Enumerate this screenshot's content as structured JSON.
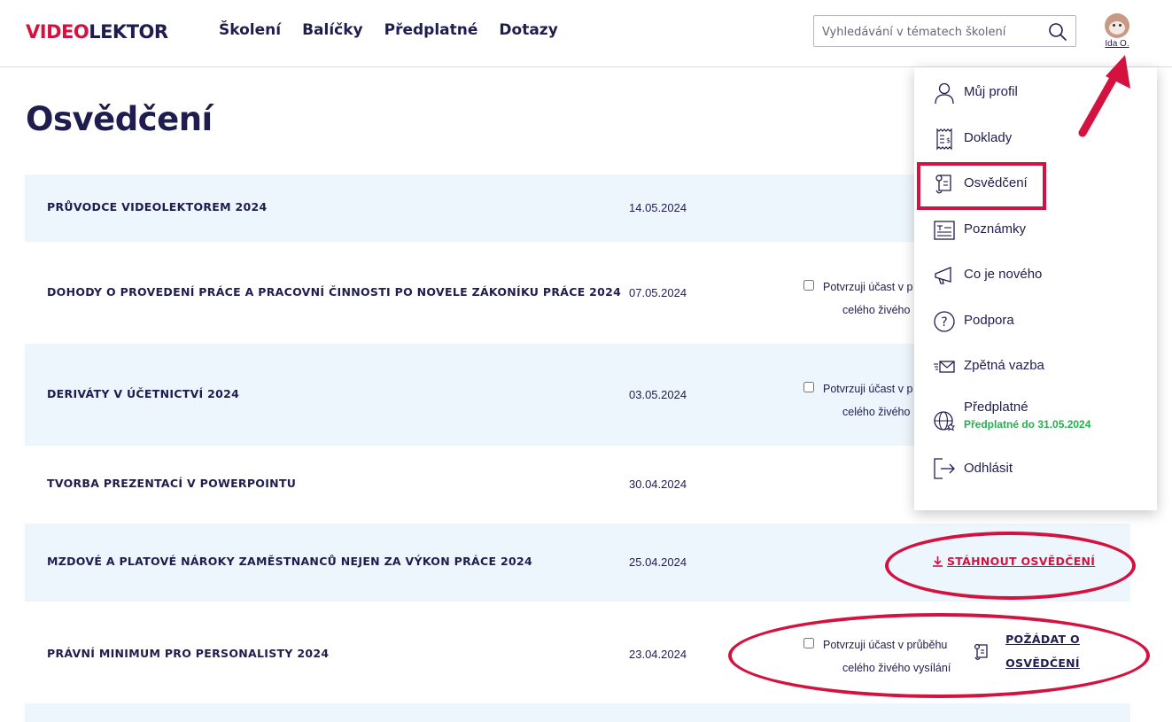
{
  "header": {
    "logo_red": "VIDEO",
    "logo_dark": "LEKTOR",
    "nav": [
      "Školení",
      "Balíčky",
      "Předplatné",
      "Dotazy"
    ],
    "search_placeholder": "Vyhledávání v tématech školení",
    "user_name": "Ida O."
  },
  "page": {
    "title": "Osvědčení"
  },
  "rows": [
    {
      "name": "Průvodce videolektorem 2024",
      "date": "14.05.2024"
    },
    {
      "name": "Dohody o provedení práce a pracovní činnosti po novele zákoníku práce 2024",
      "date": "07.05.2024",
      "confirm_1": "Potvrzuji účast v p",
      "confirm_2": "celého živého"
    },
    {
      "name": "Deriváty v účetnictví 2024",
      "date": "03.05.2024",
      "confirm_1": "Potvrzuji účast v p",
      "confirm_2": "celého živého"
    },
    {
      "name": "Tvorba prezentací v PowerPointu",
      "date": "30.04.2024"
    },
    {
      "name": "Mzdové a platové nároky zaměstnanců nejen za výkon práce 2024",
      "date": "25.04.2024",
      "action": "STÁHNOUT OSVĚDČENÍ"
    },
    {
      "name": "Právní minimum pro personalisty 2024",
      "date": "23.04.2024",
      "confirm_1": "Potvrzuji účast v průběhu",
      "confirm_2": "celého živého vysílání",
      "request_1": "POŽÁDAT O",
      "request_2": "OSVĚDČENÍ"
    }
  ],
  "menu": {
    "items": [
      {
        "label": "Můj profil",
        "icon": "user-icon"
      },
      {
        "label": "Doklady",
        "icon": "receipt-icon"
      },
      {
        "label": "Osvědčení",
        "icon": "certificate-icon"
      },
      {
        "label": "Poznámky",
        "icon": "notes-icon"
      },
      {
        "label": "Co je nového",
        "icon": "megaphone-icon"
      },
      {
        "label": "Podpora",
        "icon": "help-icon"
      },
      {
        "label": "Zpětná vazba",
        "icon": "mail-icon"
      },
      {
        "label": "Předplatné",
        "icon": "globe-icon",
        "sub": "Předplatné do 31.05.2024"
      },
      {
        "label": "Odhlásit",
        "icon": "logout-icon"
      }
    ]
  },
  "colors": {
    "accent": "#d4123f",
    "navy": "#1f1d4f",
    "row_alt": "#eef6fd",
    "success": "#22b14c"
  }
}
